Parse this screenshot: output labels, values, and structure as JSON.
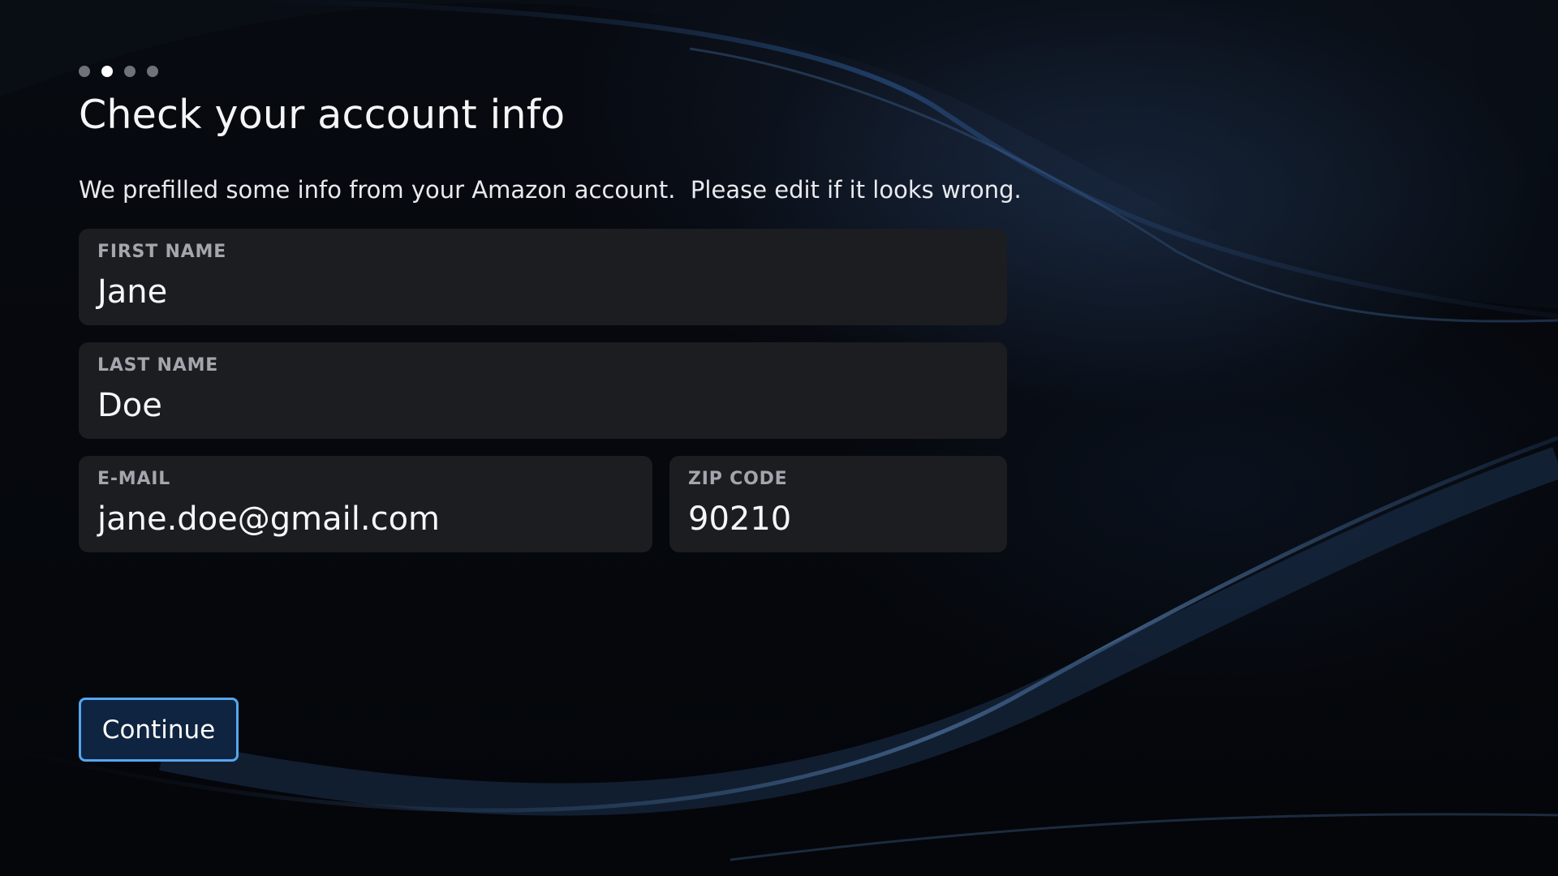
{
  "progress": {
    "total_steps": 4,
    "current_step": 2
  },
  "header": {
    "title": "Check your account info",
    "subtitle": "We prefilled some info from your Amazon account.  Please edit if it looks wrong."
  },
  "form": {
    "first_name": {
      "label": "FIRST NAME",
      "value": "Jane"
    },
    "last_name": {
      "label": "LAST NAME",
      "value": "Doe"
    },
    "email": {
      "label": "E-MAIL",
      "value": "jane.doe@gmail.com"
    },
    "zip": {
      "label": "ZIP CODE",
      "value": "90210"
    }
  },
  "actions": {
    "continue_label": "Continue"
  },
  "colors": {
    "accent": "#56a6f0",
    "field_background": "#1b1d21",
    "background": "#05070b"
  }
}
